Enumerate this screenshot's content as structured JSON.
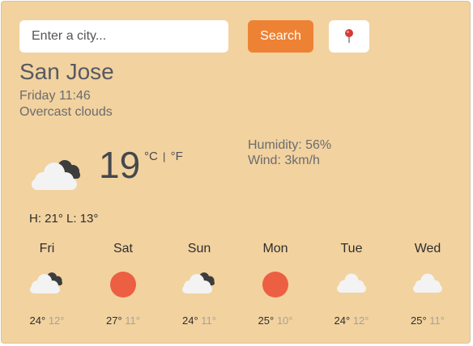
{
  "search": {
    "placeholder": "Enter a city...",
    "button_label": "Search"
  },
  "location_button": {
    "icon": "map-pin-icon"
  },
  "current": {
    "city": "San Jose",
    "datetime": "Friday 11:46",
    "condition": "Overcast clouds",
    "icon": "overcast-clouds-icon",
    "temperature": "19",
    "unit_celsius": "°C",
    "unit_separator": "|",
    "unit_fahrenheit": "°F",
    "humidity": "Humidity: 56%",
    "wind": "Wind: 3km/h",
    "high_label": "H:",
    "high": "21°",
    "low_label": "L:",
    "low": "13°"
  },
  "forecast": [
    {
      "day": "Fri",
      "icon": "overcast-clouds-icon",
      "high": "24°",
      "low": "12°"
    },
    {
      "day": "Sat",
      "icon": "sun-icon",
      "high": "27°",
      "low": "11°"
    },
    {
      "day": "Sun",
      "icon": "overcast-clouds-icon",
      "high": "24°",
      "low": "11°"
    },
    {
      "day": "Mon",
      "icon": "sun-icon",
      "high": "25°",
      "low": "10°"
    },
    {
      "day": "Tue",
      "icon": "cloud-icon",
      "high": "24°",
      "low": "12°"
    },
    {
      "day": "Wed",
      "icon": "cloud-icon",
      "high": "25°",
      "low": "11°"
    }
  ],
  "colors": {
    "background": "#f2d29f",
    "accent": "#ee8234",
    "sun": "#ec5f43",
    "dark_cloud": "#3d3d3d",
    "light_cloud": "#f3f3f3"
  }
}
